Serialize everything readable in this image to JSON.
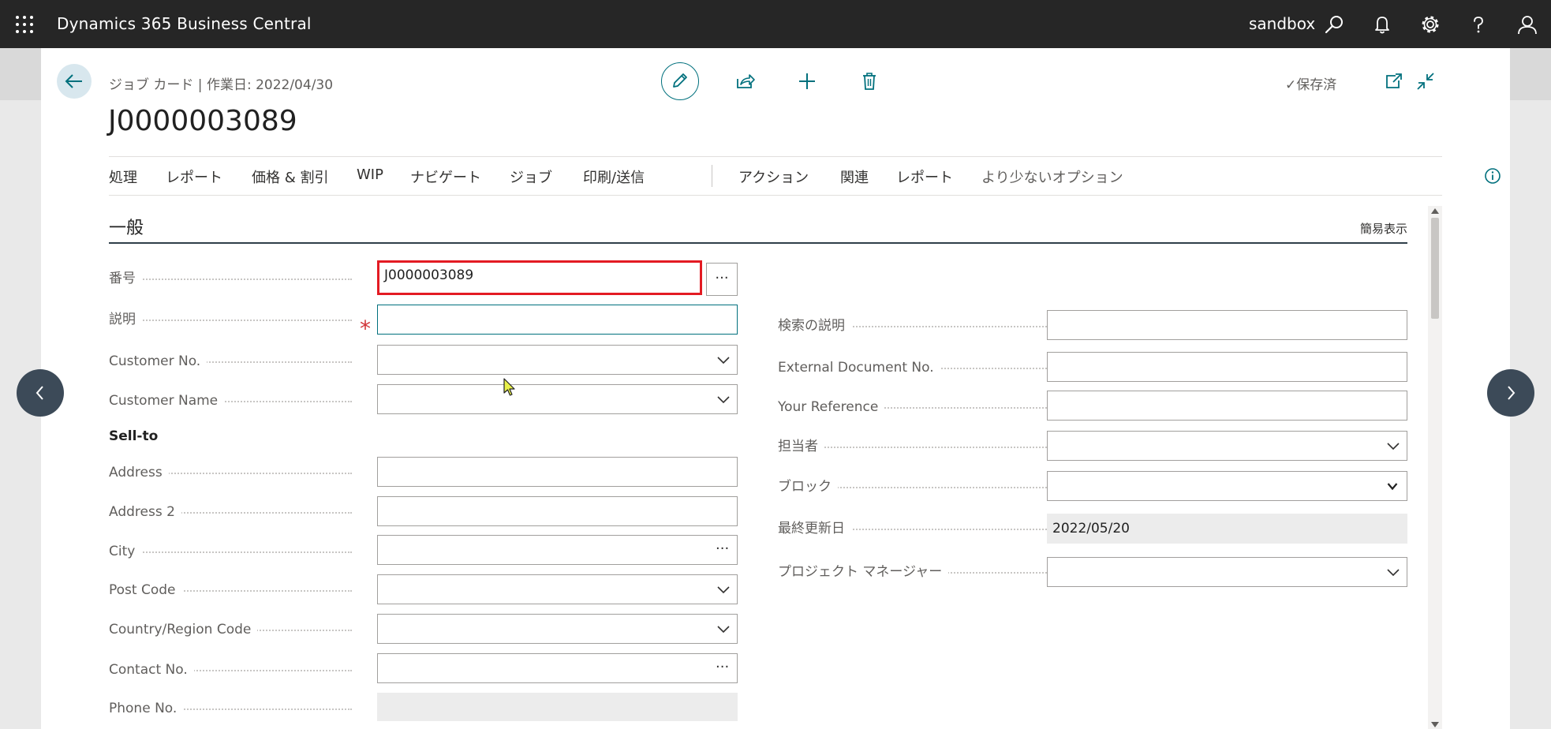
{
  "topbar": {
    "app_title": "Dynamics 365 Business Central",
    "environment": "sandbox",
    "icons": [
      "waffle-icon",
      "search-icon",
      "bell-icon",
      "gear-icon",
      "help-icon",
      "user-icon"
    ]
  },
  "header": {
    "breadcrumb": "ジョブ カード | 作業日: 2022/04/30",
    "title": "J0000003089",
    "save_status": "✓保存済",
    "icons": [
      "back-arrow-icon",
      "edit-pencil-icon",
      "share-icon",
      "plus-icon",
      "delete-icon",
      "open-new-window-icon",
      "collapse-icon"
    ]
  },
  "menu": {
    "items": [
      "処理",
      "レポート",
      "価格 & 割引",
      "WIP",
      "ナビゲート",
      "ジョブ",
      "印刷/送信"
    ],
    "items_right": [
      "アクション",
      "関連",
      "レポート",
      "より少ないオプション"
    ]
  },
  "section": {
    "title": "一般",
    "toggle": "簡易表示"
  },
  "left_fields": [
    {
      "label": "番号",
      "value": "J0000003089"
    },
    {
      "label": "説明",
      "value": ""
    },
    {
      "label": "Customer No.",
      "value": ""
    },
    {
      "label": "Customer Name",
      "value": ""
    },
    {
      "label": "Address",
      "value": ""
    },
    {
      "label": "Address 2",
      "value": ""
    },
    {
      "label": "City",
      "value": ""
    },
    {
      "label": "Post Code",
      "value": ""
    },
    {
      "label": "Country/Region Code",
      "value": ""
    },
    {
      "label": "Contact No.",
      "value": ""
    },
    {
      "label": "Phone No.",
      "value": ""
    }
  ],
  "group_label": "Sell-to",
  "right_fields": [
    {
      "label": "検索の説明",
      "value": ""
    },
    {
      "label": "External Document No.",
      "value": ""
    },
    {
      "label": "Your Reference",
      "value": ""
    },
    {
      "label": "担当者",
      "value": ""
    },
    {
      "label": "ブロック",
      "value": ""
    },
    {
      "label": "最終更新日",
      "value": "2022/05/20"
    },
    {
      "label": "プロジェクト マネージャー",
      "value": ""
    }
  ],
  "glyphs": {
    "ellipsis": "···",
    "required": "*"
  },
  "colors": {
    "topbar": "#262626",
    "accent": "#00707d",
    "highlight": "#e31b23",
    "required": "#d13438",
    "nav_circle": "#3c4a58"
  }
}
